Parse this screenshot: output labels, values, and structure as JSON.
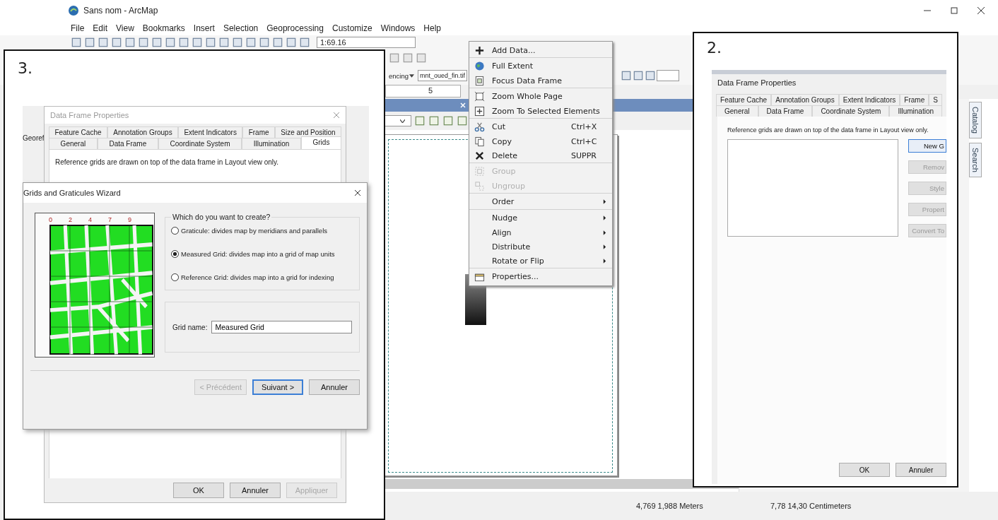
{
  "window": {
    "title": "Sans nom - ArcMap"
  },
  "menu_bar": [
    "File",
    "Edit",
    "View",
    "Bookmarks",
    "Insert",
    "Selection",
    "Geoprocessing",
    "Customize",
    "Windows",
    "Help"
  ],
  "standard_toolbar": {
    "scale": "1:69.16"
  },
  "georeferencing_toolbar": {
    "label": "encing",
    "layer": "mnt_oued_fin.tif"
  },
  "ruler": {
    "mark": "5"
  },
  "context_menu": [
    {
      "label": "Add Data...",
      "disabled": false,
      "submenu": false,
      "separator_before": false
    },
    {
      "label": "Full Extent",
      "disabled": false,
      "submenu": false,
      "separator_before": true
    },
    {
      "label": "Focus Data Frame",
      "disabled": false,
      "submenu": false,
      "separator_before": false
    },
    {
      "label": "Zoom Whole Page",
      "disabled": false,
      "submenu": false,
      "separator_before": true
    },
    {
      "label": "Zoom To Selected Elements",
      "disabled": false,
      "submenu": false,
      "separator_before": false
    },
    {
      "label": "Cut",
      "shortcut": "Ctrl+X",
      "disabled": false,
      "submenu": false,
      "separator_before": true
    },
    {
      "label": "Copy",
      "shortcut": "Ctrl+C",
      "disabled": false,
      "submenu": false,
      "separator_before": false
    },
    {
      "label": "Delete",
      "shortcut": "SUPPR",
      "disabled": false,
      "submenu": false,
      "separator_before": false
    },
    {
      "label": "Group",
      "disabled": true,
      "submenu": false,
      "separator_before": true
    },
    {
      "label": "Ungroup",
      "disabled": true,
      "submenu": false,
      "separator_before": false
    },
    {
      "label": "Order",
      "disabled": false,
      "submenu": true,
      "separator_before": true
    },
    {
      "label": "Nudge",
      "disabled": false,
      "submenu": true,
      "separator_before": true
    },
    {
      "label": "Align",
      "disabled": false,
      "submenu": true,
      "separator_before": false
    },
    {
      "label": "Distribute",
      "disabled": false,
      "submenu": true,
      "separator_before": false
    },
    {
      "label": "Rotate or Flip",
      "disabled": false,
      "submenu": true,
      "separator_before": false
    },
    {
      "label": "Properties...",
      "disabled": false,
      "submenu": false,
      "separator_before": true
    }
  ],
  "status_bar": {
    "map_coordinates": "4,769  1,988 Meters",
    "page_coordinates": "7,78  14,30 Centimeters"
  },
  "side_tabs": [
    "Catalog",
    "Search"
  ],
  "callout_3": {
    "label": "3.",
    "background_toolbar": {
      "label": "Georef"
    },
    "data_frame_properties": {
      "title": "Data Frame Properties",
      "tab_rows": [
        [
          {
            "label": "Feature Cache",
            "selected": false
          },
          {
            "label": "Annotation Groups",
            "selected": false
          },
          {
            "label": "Extent Indicators",
            "selected": false
          },
          {
            "label": "Frame",
            "selected": false
          },
          {
            "label": "Size and Position",
            "selected": false
          }
        ],
        [
          {
            "label": "General",
            "selected": false
          },
          {
            "label": "Data Frame",
            "selected": false
          },
          {
            "label": "Coordinate System",
            "selected": false
          },
          {
            "label": "Illumination",
            "selected": false
          },
          {
            "label": "Grids",
            "selected": true
          }
        ]
      ],
      "description": "Reference grids are drawn on top of the data frame in Layout view only.",
      "buttons": [
        {
          "label": "OK",
          "disabled": false
        },
        {
          "label": "Annuler",
          "disabled": false
        },
        {
          "label": "Appliquer",
          "disabled": true
        }
      ]
    },
    "wizard": {
      "title": "Grids and Graticules Wizard",
      "preview_ticks": [
        "0",
        "2",
        "4",
        "7",
        "9"
      ],
      "question": "Which do you want to create?",
      "options": [
        {
          "label": "Graticule: divides map by meridians and parallels",
          "selected": false
        },
        {
          "label": "Measured Grid: divides map into a grid of map units",
          "selected": true
        },
        {
          "label": "Reference Grid: divides map into a grid for indexing",
          "selected": false
        }
      ],
      "grid_name_label": "Grid name:",
      "grid_name": "Measured Grid",
      "buttons": [
        {
          "label": "< Précédent",
          "disabled": true,
          "default": false
        },
        {
          "label": "Suivant >",
          "disabled": false,
          "default": true
        },
        {
          "label": "Annuler",
          "disabled": false,
          "default": false
        }
      ]
    }
  },
  "callout_2": {
    "label": "2.",
    "dialog": {
      "title": "Data Frame Properties",
      "tab_rows": [
        [
          {
            "label": "Feature Cache",
            "selected": false
          },
          {
            "label": "Annotation Groups",
            "selected": false
          },
          {
            "label": "Extent Indicators",
            "selected": false
          },
          {
            "label": "Frame",
            "selected": false
          },
          {
            "label": "S",
            "selected": false
          }
        ],
        [
          {
            "label": "General",
            "selected": false
          },
          {
            "label": "Data Frame",
            "selected": false
          },
          {
            "label": "Coordinate System",
            "selected": false
          },
          {
            "label": "Illumination",
            "selected": false
          }
        ]
      ],
      "description": "Reference grids are drawn on top of the data frame in Layout view only.",
      "side_buttons": [
        {
          "label": "New G",
          "disabled": false
        },
        {
          "label": "Remov",
          "disabled": true
        },
        {
          "label": "Style",
          "disabled": true
        },
        {
          "label": "Propert",
          "disabled": true
        },
        {
          "label": "Convert To",
          "disabled": true
        }
      ],
      "buttons": [
        {
          "label": "OK",
          "disabled": false
        },
        {
          "label": "Annuler",
          "disabled": false
        }
      ]
    }
  }
}
